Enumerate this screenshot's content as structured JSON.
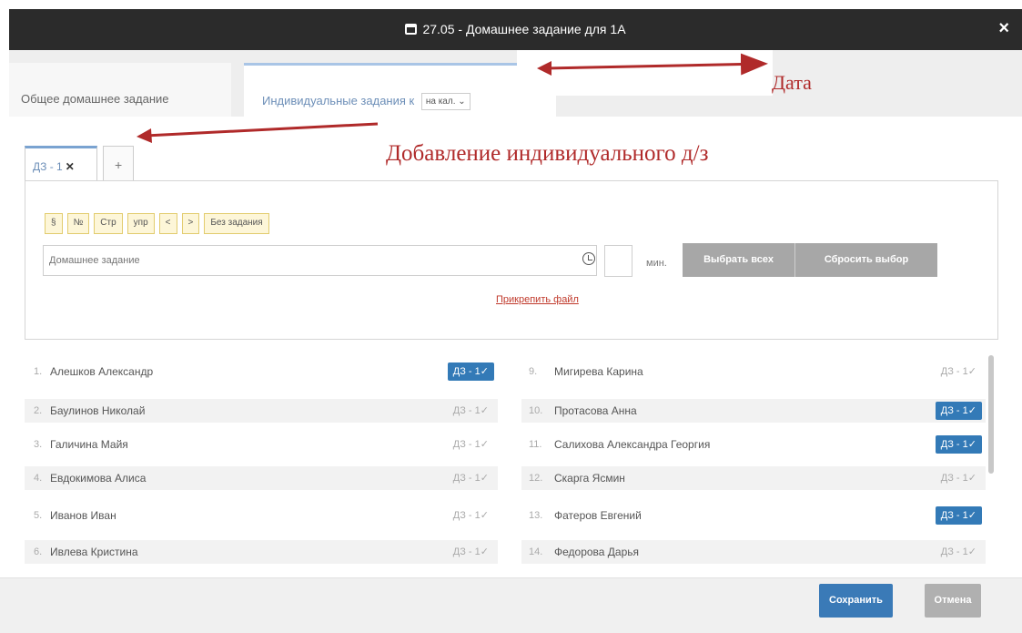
{
  "window": {
    "title": "27.05 - Домашнее задание для 1А",
    "close_label": "×"
  },
  "tabs": {
    "general": "Общее домашнее задание",
    "individual": "Индивидуальные задания к",
    "individual_select": "на кал. ⌄"
  },
  "annotations": {
    "date": "Дата",
    "add_individual": "Добавление индивидуального д/з"
  },
  "hw_tabs": {
    "active": "ДЗ - 1",
    "close": "✕",
    "add": "+"
  },
  "chips": [
    "§",
    "№",
    "Стр",
    "упр",
    "<",
    ">",
    "Без задания"
  ],
  "homework": {
    "placeholder": "Домашнее задание",
    "minutes_label": "мин.",
    "select_all": "Выбрать всех",
    "reset": "Сбросить выбор",
    "attach": "Прикрепить файл"
  },
  "students_left": [
    {
      "num": "1.",
      "name": "Алешков Александр",
      "badge": "ДЗ - 1✓",
      "selected": true
    },
    {
      "num": "2.",
      "name": "Баулинов Николай",
      "badge": "ДЗ - 1✓",
      "selected": false
    },
    {
      "num": "3.",
      "name": "Галичина Майя",
      "badge": "ДЗ - 1✓",
      "selected": false
    },
    {
      "num": "4.",
      "name": "Евдокимова Алиса",
      "badge": "ДЗ - 1✓",
      "selected": false
    },
    {
      "num": "5.",
      "name": "Иванов Иван",
      "badge": "ДЗ - 1✓",
      "selected": false
    },
    {
      "num": "6.",
      "name": "Ивлева Кристина",
      "badge": "ДЗ - 1✓",
      "selected": false
    }
  ],
  "students_right": [
    {
      "num": "9.",
      "name": "Мигирева Карина",
      "badge": "ДЗ - 1✓",
      "selected": false
    },
    {
      "num": "10.",
      "name": "Протасова Анна",
      "badge": "ДЗ - 1✓",
      "selected": true
    },
    {
      "num": "11.",
      "name": "Салихова Александра Георгия",
      "badge": "ДЗ - 1✓",
      "selected": true
    },
    {
      "num": "12.",
      "name": "Скарга Ясмин",
      "badge": "ДЗ - 1✓",
      "selected": false
    },
    {
      "num": "13.",
      "name": "Фатеров Евгений",
      "badge": "ДЗ - 1✓",
      "selected": true
    },
    {
      "num": "14.",
      "name": "Федорова Дарья",
      "badge": "ДЗ - 1✓",
      "selected": false
    }
  ],
  "footer": {
    "save": "Сохранить",
    "cancel": "Отмена"
  },
  "colors": {
    "primary": "#337ab7",
    "annotation": "#b02a2a",
    "chip": "#fdf6d8"
  }
}
